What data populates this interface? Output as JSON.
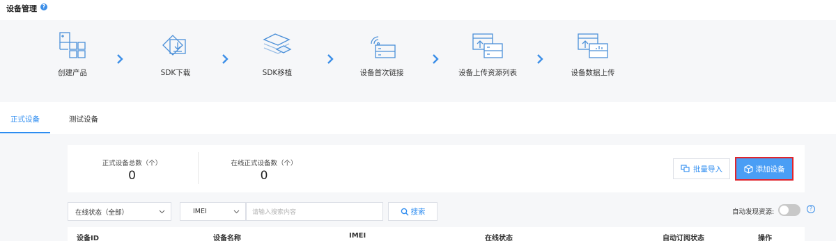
{
  "header": {
    "title": "设备管理",
    "help_icon": "?"
  },
  "steps": [
    {
      "label": "创建产品",
      "icon": "create-product-icon"
    },
    {
      "label": "SDK下载",
      "icon": "sdk-download-icon"
    },
    {
      "label": "SDK移植",
      "icon": "sdk-port-icon"
    },
    {
      "label": "设备首次链接",
      "icon": "device-link-icon"
    },
    {
      "label": "设备上传资源列表",
      "icon": "upload-resource-icon"
    },
    {
      "label": "设备数据上传",
      "icon": "data-upload-icon"
    }
  ],
  "tabs": [
    {
      "label": "正式设备",
      "active": true
    },
    {
      "label": "测试设备",
      "active": false
    }
  ],
  "stats": {
    "total_label": "正式设备总数（个）",
    "total_value": "0",
    "online_label": "在线正式设备数（个）",
    "online_value": "0"
  },
  "buttons": {
    "import_label": "批量导入",
    "add_label": "添加设备"
  },
  "filters": {
    "status_select": "在线状态（全部）",
    "field_select": "IMEI",
    "search_placeholder": "请输入搜索内容",
    "search_label": "搜索",
    "auto_discover_label": "自动发现资源:",
    "auto_discover_on": false,
    "help_icon": "?"
  },
  "table": {
    "columns": [
      "设备ID",
      "设备名称",
      "IMEI",
      "在线状态",
      "自动订阅状态",
      "操作"
    ]
  },
  "colors": {
    "accent": "#2d8cf0",
    "primary_button": "#4a9ef5",
    "highlight_border": "#e0242c",
    "background": "#f6f7f9"
  }
}
